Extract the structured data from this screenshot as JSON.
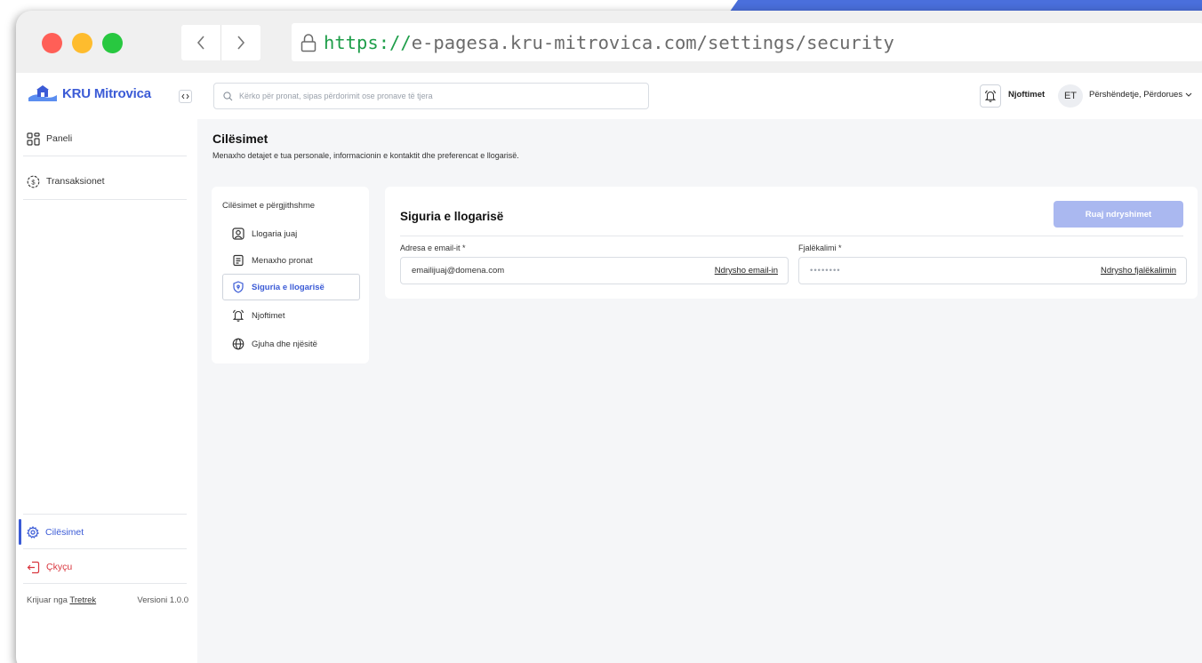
{
  "browser": {
    "url_scheme": "https://",
    "url_rest": "e-pagesa.kru-mitrovica.com/settings/security",
    "back_icon": "chevron-left-icon",
    "forward_icon": "chevron-right-icon",
    "lock_icon": "lock-icon"
  },
  "sidebar": {
    "brand": "KRU Mitrovica",
    "items": [
      {
        "label": "Paneli",
        "icon": "dashboard-grid-icon"
      },
      {
        "label": "Transaksionet",
        "icon": "coin-icon"
      }
    ],
    "settings_label": "Cilësimet",
    "logout_label": "Çkyçu",
    "footer_prefix": "Krijuar nga",
    "footer_link": "Tretrek",
    "version": "Versioni 1.0.0"
  },
  "topbar": {
    "search_placeholder": "Kërko për pronat, sipas përdorimit ose pronave të tjera",
    "notifications_label": "Njoftimet",
    "avatar_initials": "ET",
    "greeting": "Përshëndetje, Përdorues"
  },
  "page": {
    "title": "Cilësimet",
    "subtitle": "Menaxho detajet e tua personale, informacionin e kontaktit dhe preferencat e llogarisë."
  },
  "subnav": {
    "heading": "Cilësimet e përgjithshme",
    "items": [
      {
        "label": "Llogaria juaj",
        "icon": "user-icon"
      },
      {
        "label": "Menaxho pronat",
        "icon": "document-icon"
      },
      {
        "label": "Siguria e llogarisë",
        "icon": "shield-icon"
      },
      {
        "label": "Njoftimet",
        "icon": "bell-icon"
      },
      {
        "label": "Gjuha dhe njësitë",
        "icon": "globe-icon"
      }
    ],
    "active_index": 2
  },
  "security": {
    "title": "Siguria e llogarisë",
    "save_label": "Ruaj ndryshimet",
    "email_label": "Adresa e email-it *",
    "email_value": "emailijuaj@domena.com",
    "email_link": "Ndrysho email-in",
    "password_label": "Fjalëkalimi *",
    "password_value": "••••••••",
    "password_link": "Ndrysho fjalëkalimin"
  },
  "colors": {
    "accent": "#3b5bd6",
    "save_disabled": "#aab8f0",
    "logout": "#d9363e",
    "url_scheme": "#1f9e4a"
  }
}
